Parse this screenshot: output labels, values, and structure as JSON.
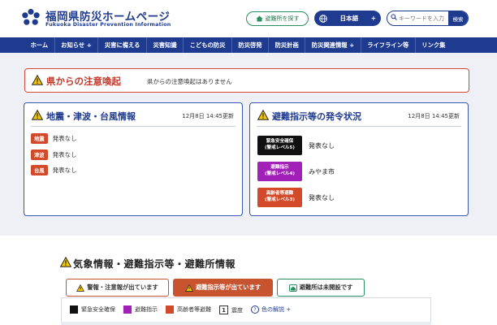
{
  "header": {
    "site_title": "福岡県防災ホームページ",
    "site_subtitle": "Fukuoka Disaster Prevention Information",
    "shelter_button": "避難所を探す",
    "language": {
      "label": "日本語",
      "arrow": "+"
    },
    "search": {
      "placeholder": "キーワードを入力",
      "button": "検索"
    }
  },
  "nav": {
    "items": [
      {
        "label": "ホーム"
      },
      {
        "label": "お知らせ +"
      },
      {
        "label": "災害に備える"
      },
      {
        "label": "災害知識"
      },
      {
        "label": "こどもの防災"
      },
      {
        "label": "防災啓発"
      },
      {
        "label": "防災計画"
      },
      {
        "label": "防災関連情報 +"
      },
      {
        "label": "ライフライン等"
      },
      {
        "label": "リンク集"
      }
    ]
  },
  "prefecture_alert": {
    "title": "県からの注意喚起",
    "message": "県からの注意喚起はありません"
  },
  "quake_card": {
    "title": "地震・津波・台風情報",
    "updated": "12月8日 14:45更新",
    "rows": [
      {
        "tag": "地震",
        "text": "発表なし"
      },
      {
        "tag": "津波",
        "text": "発表なし"
      },
      {
        "tag": "台風",
        "text": "発表なし"
      }
    ]
  },
  "evac_card": {
    "title": "避難指示等の発令状況",
    "updated": "12月8日 14:45更新",
    "rows": [
      {
        "line1": "緊急安全確保",
        "line2": "(警戒レベル5)",
        "color": "#111111",
        "text": "発表なし"
      },
      {
        "line1": "避難指示",
        "line2": "(警戒レベル4)",
        "color": "#a020b8",
        "text": "みやま市"
      },
      {
        "line1": "高齢者等避難",
        "line2": "(警戒レベル3)",
        "color": "#d24a2a",
        "text": "発表なし"
      }
    ]
  },
  "lower": {
    "section_title": "気象情報・避難指示等・避難所情報",
    "tabs": [
      {
        "label": "警報・注意報が出ています"
      },
      {
        "label": "避難指示等が出ています"
      },
      {
        "label": "避難所は未開設です"
      }
    ],
    "legend": [
      {
        "label": "緊急安全確保",
        "color": "#111111"
      },
      {
        "label": "避難指示",
        "color": "#a020b8"
      },
      {
        "label": "高齢者等避難",
        "color": "#d24a2a"
      }
    ],
    "quake_legend": {
      "number": "1",
      "label": "震度"
    },
    "help_label": "色の解説 +"
  },
  "colors": {
    "brand": "#1f3b8f",
    "alert_red": "#c23a2b",
    "shelter_green": "#2a8f5e",
    "tab_orange": "#c7532f"
  }
}
